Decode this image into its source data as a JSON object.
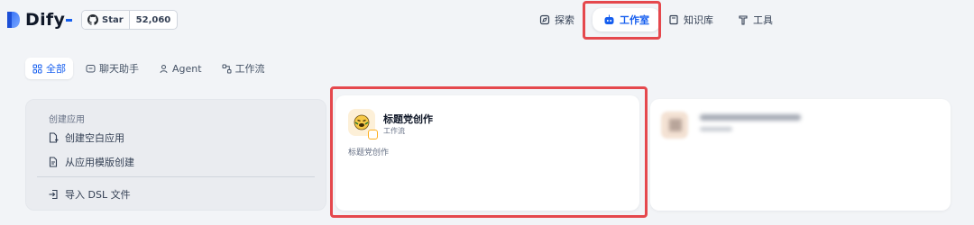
{
  "brand": {
    "name": "Dify"
  },
  "github": {
    "star_label": "Star",
    "star_count": "52,060"
  },
  "nav": {
    "explore": "探索",
    "studio": "工作室",
    "knowledge": "知识库",
    "tools": "工具"
  },
  "tabs": [
    {
      "label": "全部",
      "icon": "grid-icon",
      "active": true
    },
    {
      "label": "聊天助手",
      "icon": "chat-icon",
      "active": false
    },
    {
      "label": "Agent",
      "icon": "agent-icon",
      "active": false
    },
    {
      "label": "工作流",
      "icon": "workflow-icon",
      "active": false
    }
  ],
  "create": {
    "title": "创建应用",
    "blank": "创建空白应用",
    "template": "从应用模版创建",
    "import": "导入 DSL 文件"
  },
  "app": {
    "name": "标题党创作",
    "type": "工作流",
    "description": "标题党创作"
  },
  "colors": {
    "accent": "#155eef",
    "highlight": "#e5484d",
    "background": "#f2f4f7"
  }
}
